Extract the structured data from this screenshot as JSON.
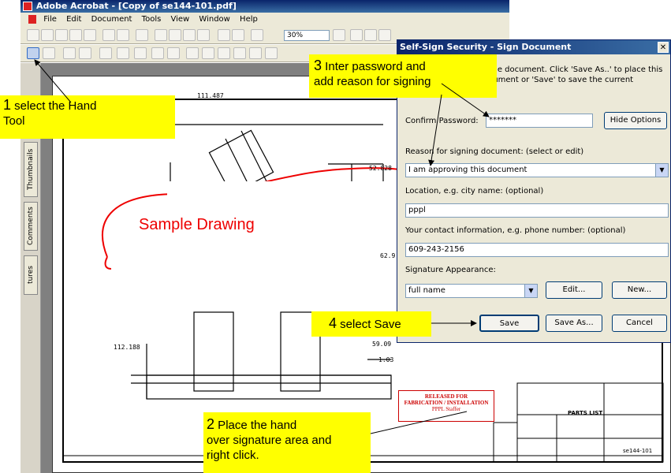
{
  "app": {
    "title": "Adobe Acrobat - [Copy of se144-101.pdf]",
    "menu": [
      "File",
      "Edit",
      "Document",
      "Tools",
      "View",
      "Window",
      "Help"
    ],
    "zoom": "30%"
  },
  "left_tabs": {
    "thumbnails": "Thumbnails",
    "comments": "Comments",
    "signatures": "tures"
  },
  "drawing": {
    "label": "Sample Drawing",
    "dimensions": [
      "111.487",
      "52.828",
      "62.9",
      "112.188",
      "59.09",
      "1.03"
    ],
    "released_stamp": {
      "line1": "RELEASED FOR",
      "line2": "FABRICATION / INSTALLATION",
      "line3": "PPPL Staffer"
    },
    "title_block": {
      "parts_list": "PARTS LIST",
      "drawing_no": "se144-101"
    }
  },
  "dialog": {
    "title": "Self-Sign Security - Sign Document",
    "intro_line1": "ving the document. Click 'Save As..' to place this",
    "intro_line2": "w document or 'Save' to save the current",
    "confirm_password_label": "Confirm Password:",
    "confirm_password_value": "*******",
    "hide_options_label": "Hide Options",
    "reason_label": "Reason for signing document: (select or edit)",
    "reason_value": "I am approving this document",
    "location_label": "Location, e.g. city name: (optional)",
    "location_value": "pppl",
    "contact_label": "Your contact information, e.g. phone number: (optional)",
    "contact_value": "609-243-2156",
    "appearance_label": "Signature Appearance:",
    "appearance_value": "full name",
    "edit_label": "Edit...",
    "new_label": "New...",
    "save_label": "Save",
    "save_as_label": "Save As...",
    "cancel_label": "Cancel"
  },
  "callouts": {
    "c1": {
      "num": "1",
      "text": " select the Hand",
      "text2": "Tool"
    },
    "c2": {
      "num": "2",
      "text": " Place the hand",
      "text2": "over signature area and",
      "text3": "right click."
    },
    "c3": {
      "num": "3",
      "text": " Inter password and",
      "text2": "add reason for signing"
    },
    "c4": {
      "num": "4",
      "text": " select Save"
    }
  },
  "colors": {
    "callout_bg": "#ffff00",
    "titlebar": "#0a246a",
    "sample_label": "#ee0000",
    "released_stamp": "#cc0000"
  }
}
